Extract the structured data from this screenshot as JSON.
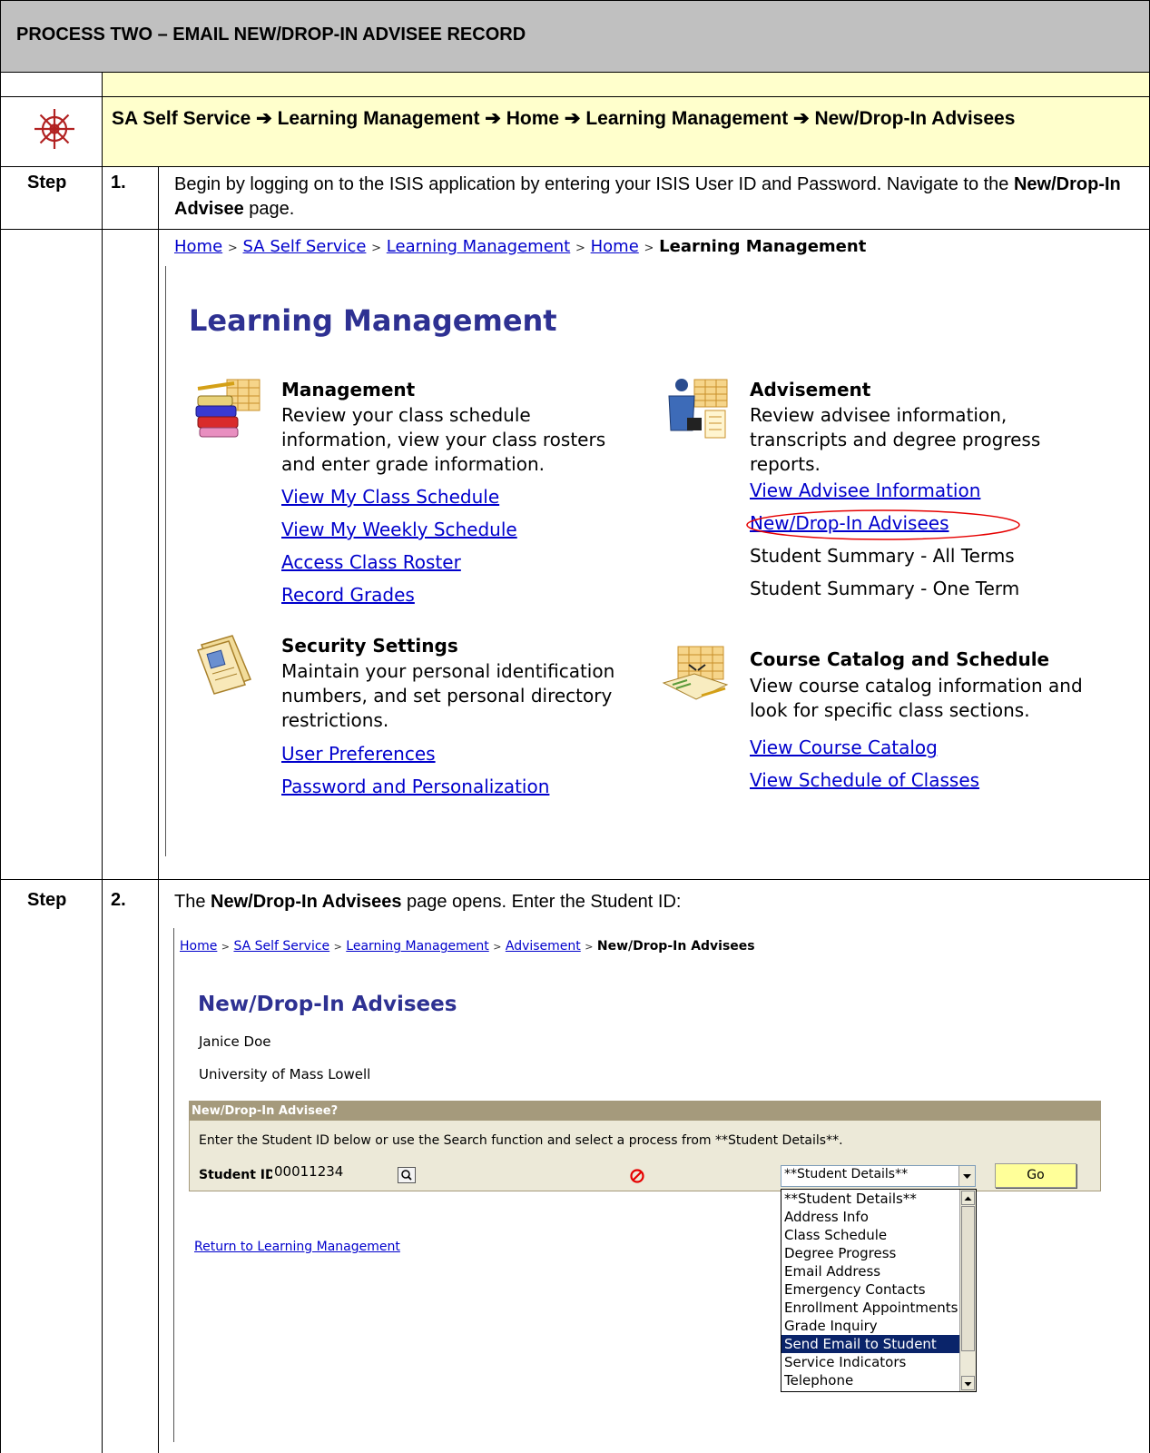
{
  "header": {
    "title": "PROCESS TWO – EMAIL NEW/DROP-IN ADVISEE RECORD"
  },
  "nav_path": "SA Self Service ➔ Learning Management ➔ Home ➔ Learning Management ➔ New/Drop-In Advisees",
  "step1": {
    "label": "Step",
    "number": "1.",
    "text_before": "Begin by logging on to the ISIS application by entering your ISIS User ID and Password. Navigate to the ",
    "text_bold": "New/Drop-In Advisee",
    "text_after": " page."
  },
  "screen1": {
    "breadcrumb": {
      "links": [
        "Home",
        "SA Self Service",
        "Learning Management",
        "Home"
      ],
      "current": "Learning Management",
      "separator": ">"
    },
    "page_title": "Learning Management",
    "management": {
      "title": "Management",
      "desc": "Review your class schedule information, view your class rosters and enter grade information.",
      "links": [
        "View My Class Schedule",
        "View My Weekly Schedule",
        "Access Class Roster",
        "Record Grades"
      ]
    },
    "advisement": {
      "title": "Advisement",
      "desc": "Review advisee information, transcripts and degree progress reports.",
      "links": [
        "View Advisee Information",
        "New/Drop-In Advisees"
      ],
      "items": [
        "Student Summary - All Terms",
        "Student Summary - One Term"
      ]
    },
    "security": {
      "title": "Security Settings",
      "desc": "Maintain your personal identification numbers, and set personal directory restrictions.",
      "links": [
        "User Preferences",
        "Password and Personalization"
      ]
    },
    "catalog": {
      "title": "Course Catalog and Schedule",
      "desc": "View course catalog information and look for specific class sections.",
      "links": [
        "View Course Catalog",
        "View Schedule of Classes"
      ]
    }
  },
  "step2": {
    "label": "Step",
    "number": "2.",
    "text_before": "The ",
    "text_bold": "New/Drop-In Advisees",
    "text_after": " page opens. Enter the Student ID:"
  },
  "screen2": {
    "breadcrumb": {
      "links": [
        "Home",
        "SA Self Service",
        "Learning Management",
        "Advisement"
      ],
      "current": "New/Drop-In Advisees",
      "separator": ">"
    },
    "page_title": "New/Drop-In Advisees",
    "user_name": "Janice Doe",
    "institution": "University of Mass Lowell",
    "box_title": "New/Drop-In Advisee?",
    "instruction": "Enter the Student ID below or use the Search function and select a process from **Student Details**.",
    "student_id_label": "Student ID:",
    "student_id_value": "00011234",
    "select_value": "**Student Details**",
    "go_label": "Go",
    "return_link": "Return to Learning Management",
    "options": [
      "**Student Details**",
      "Address Info",
      "Class Schedule",
      "Degree Progress",
      "Email Address",
      "Emergency Contacts",
      "Enrollment Appointments",
      "Grade Inquiry",
      "Send Email to Student",
      "Service Indicators",
      "Telephone"
    ],
    "selected_option": "Send Email to Student"
  },
  "colors": {
    "header_bg": "#c0c0c0",
    "nav_bg": "#ffffcc",
    "link": "#0000cc",
    "ps_title": "#2e3192",
    "box_header": "#a59a7c",
    "box_bg": "#ece9d8",
    "go_bg": "#ffff99",
    "select_highlight": "#0a246a",
    "annotation": "#e60000"
  }
}
